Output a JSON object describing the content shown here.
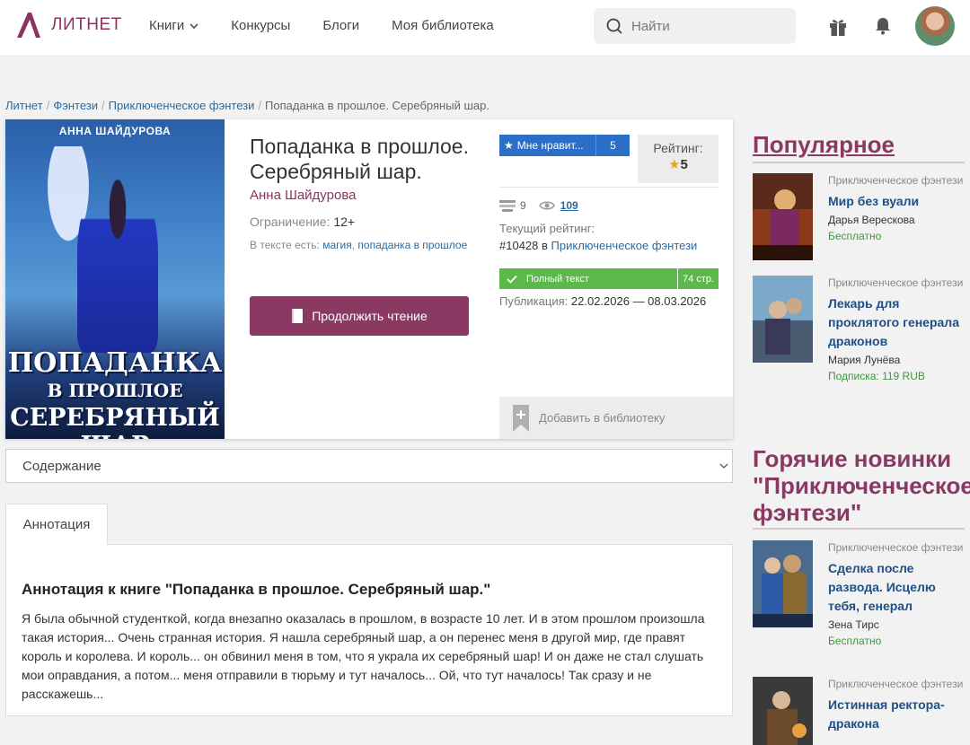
{
  "header": {
    "logo_text": "ЛИТНЕТ",
    "nav": [
      "Книги",
      "Конкурсы",
      "Блоги",
      "Моя библиотека"
    ],
    "search_placeholder": "Найти",
    "icons": [
      "search-icon",
      "gift-icon",
      "bell-icon",
      "avatar"
    ]
  },
  "breadcrumb": [
    "Литнет",
    "Фэнтези",
    "Приключенческое фэнтези",
    "Попаданка в прошлое. Серебряный шар."
  ],
  "book": {
    "cover": {
      "author": "АННА ШАЙДУРОВА",
      "title_line1": "ПОПАДАНКА",
      "title_line2": "В ПРОШЛОЕ",
      "title_line3": "СЕРЕБРЯНЫЙ ШАР"
    },
    "title": "Попаданка в прошлое. Серебряный шар.",
    "author": "Анна Шайдурова",
    "restriction_label": "Ограничение:",
    "restriction_value": "12+",
    "tags_label": "В тексте есть:",
    "tags": [
      "магия",
      "попаданка в прошлое"
    ],
    "read_button": "Продолжить чтение",
    "like_label": "Мне нравит...",
    "like_count": "5",
    "rating_label": "Рейтинг:",
    "rating_value": "5",
    "comments_count": "9",
    "views_count": "109",
    "current_rating_label": "Текущий рейтинг:",
    "current_rating_rank": "#10428 в",
    "current_rating_category": "Приключенческое фэнтези",
    "full_text_label": "Полный текст",
    "pages": "74 стр.",
    "publication_label": "Публикация:",
    "publication_dates": "22.02.2026 — 08.03.2026",
    "add_library": "Добавить в библиотеку"
  },
  "contents": {
    "selected": "Содержание"
  },
  "annotation": {
    "tab": "Аннотация",
    "heading": "Аннотация к книге \"Попаданка в прошлое. Серебряный шар.\"",
    "text": "Я была обычной студенткой, когда внезапно оказалась в прошлом, в возрасте 10 лет. И в этом прошлом произошла такая история... Очень странная история. Я нашла серебряный шар, а он перенес меня в другой мир, где правят король и королева. И король... он обвинил меня в том, что я украла их серебряный шар! И он даже не стал слушать мои оправдания, а потом... меня отправили в тюрьму и тут началось... Ой, что тут началось! Так сразу и не расскажешь..."
  },
  "popular": {
    "title": "Популярное",
    "items": [
      {
        "genre": "Приключенческое фэнтези",
        "name": "Мир без вуали",
        "author": "Дарья Верескова",
        "price": "Бесплатно"
      },
      {
        "genre": "Приключенческое фэнтези",
        "name": "Лекарь для проклятого генерала драконов",
        "author": "Мария Лунёва",
        "price": "Подписка: 119 RUB"
      }
    ]
  },
  "hot": {
    "title": "Горячие новинки \"Приключенческое фэнтези\"",
    "items": [
      {
        "genre": "Приключенческое фэнтези",
        "name": "Сделка после развода. Исцелю тебя, генерал",
        "author": "Зена Тирс",
        "price": "Бесплатно"
      },
      {
        "genre": "Приключенческое фэнтези",
        "name": "Истинная ректора-дракона",
        "author": "",
        "price": ""
      }
    ]
  },
  "colors": {
    "brand": "#8a3560",
    "link": "#2a6aa0",
    "like": "#2a6ec7",
    "complete": "#5cb84a"
  }
}
